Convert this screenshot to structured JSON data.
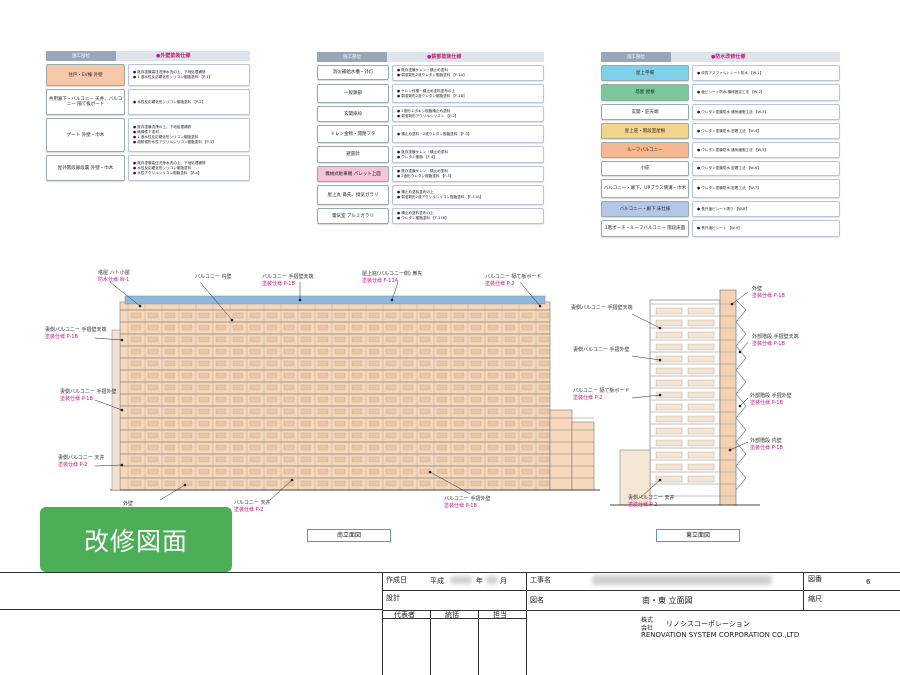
{
  "spec_tables": [
    {
      "header_label": "施工部位",
      "header_title": "●外壁塗装仕様",
      "rows": [
        {
          "name": "住戸・EV棟 外壁",
          "lines": [
            "● 既存塗膜高圧洗浄水洗の上、下地処理補修",
            "● 1 液水性反応硬化形シリコン樹脂塗料 【P-1】"
          ],
          "bg": "#f6c8a8"
        },
        {
          "name": "共用廊下・バルコニー 天井、バルコニー 隔て板ボード",
          "lines": [
            "● 水性反応硬化形シリコン樹脂塗料 【P-2】"
          ],
          "bg": "#ffffff"
        },
        {
          "name": "ゲート 外壁・巾木",
          "lines": [
            "● 既存塗膜洗浄の上、下地処理補修",
            "● 微弾性下塗材",
            "● 1 液水性反応硬化形シリコン樹脂塗料",
            "● 超耐候形水性アクリルシリコン樹脂塗料 【P-3】"
          ],
          "bg": "#ffffff"
        },
        {
          "name": "屋外階段廊段裏 外壁・巾木",
          "lines": [
            "● 既存塗膜高圧洗浄水洗の上、下地処理補修",
            "● 水性反応硬化形シリコン樹脂塗料",
            "● 水性アクリルシリコン樹脂塗料 【P-4】"
          ],
          "bg": "#ffffff"
        }
      ]
    },
    {
      "header_label": "施工部位",
      "header_title": "●鉄部塗装仕様",
      "rows": [
        {
          "name": "消火補給水槽・外灯",
          "lines": [
            "● 既存塗膜ケレン・錆止め塗料",
            "● 弱溶剤形2液ウレタン樹脂塗料 【F-1A】"
          ],
          "bg": "#ffffff"
        },
        {
          "name": "一般鉄部",
          "lines": [
            "● ケレン作業・錆止め塗料塗布の上",
            "● 弱溶剤形2液ウレタン樹脂塗料 【F-1B】"
          ],
          "bg": "#ffffff"
        },
        {
          "name": "玄関扉枠",
          "lines": [
            "● 2液形エポキシ樹脂錆止め塗料",
            "● 弱溶剤形アクリルシリコン 【F-2】"
          ],
          "bg": "#ffffff"
        },
        {
          "name": "ドレン金物・開閉フタ",
          "lines": [
            "● 錆止め塗料・2液ウレタン樹脂塗料 【F-3】"
          ],
          "bg": "#ffffff"
        },
        {
          "name": "避雷針",
          "lines": [
            "● 既存塗膜ケレン・錆止め塗料",
            "● ウレタン樹脂 【F-4】"
          ],
          "bg": "#ffffff"
        },
        {
          "name": "機械式駐車機 パレット上面",
          "lines": [
            "● 既存塗膜ケレン・錆止め塗料",
            "● 2液形ウレタン樹脂塗料 【F-5】"
          ],
          "bg": "#f7c3d9"
        },
        {
          "name": "屋上丸 鼻先、換気ガラリ",
          "lines": [
            "● 錆止め塗料塗布の上",
            "● 弱溶剤形2液アクリルシリコン樹脂塗料 【F-11A】"
          ],
          "bg": "#ffffff"
        },
        {
          "name": "電気室 アルミガラリ",
          "lines": [
            "● 錆止め塗料塗布の上",
            "● ウレタン樹脂塗料 【F-11B】"
          ],
          "bg": "#ffffff"
        }
      ]
    },
    {
      "header_label": "施工部位",
      "header_title": "●防水改修仕様",
      "rows": [
        {
          "name": "屋上平場",
          "lines": [
            "● 改質アスファルトシート防水 【W-1】"
          ],
          "bg": "#7fd0e8"
        },
        {
          "name": "塔屋 屋根",
          "lines": [
            "● 塩ビシート防水 機械固定工法 【W-2】"
          ],
          "bg": "#7cc79b"
        },
        {
          "name": "玄関・庇天端",
          "lines": [
            "● ウレタン塗膜防水 通気緩衝工法 【W-3】"
          ],
          "bg": "#ffffff"
        },
        {
          "name": "屋上庇・階段室屋根",
          "lines": [
            "● ウレタン塗膜防水 密着工法 【W-4】"
          ],
          "bg": "#f2d58a"
        },
        {
          "name": "ルーフバルコニー",
          "lines": [
            "● ウレタン塗膜防水 通気緩衝工法 【W-5】"
          ],
          "bg": "#f6b88e"
        },
        {
          "name": "小庇",
          "lines": [
            "● ウレタン塗膜防水 密着工法 【W-6】"
          ],
          "bg": "#ffffff"
        },
        {
          "name": "バルコニー・廊下、UPプラス側溝・巾木",
          "lines": [
            "● ウレタン塗膜防水 密着工法 【W-7】"
          ],
          "bg": "#ffffff"
        },
        {
          "name": "バルコニー・廊下 床仕様",
          "lines": [
            "● 長尺塩ビシート張り 【W-8】"
          ],
          "bg": "#b4c6ea"
        },
        {
          "name": "1階ポーチ・ルーフバルコニー 階段床面",
          "lines": [
            "● 長尺塩ビシート 【W-9】"
          ],
          "bg": "#ffffff"
        }
      ]
    }
  ],
  "south_callouts": [
    {
      "title": "塔屋 ハト小屋",
      "spec": "防水仕様 W-1"
    },
    {
      "title": "バルコニー 内壁",
      "spec": ""
    },
    {
      "title": "バルコニー 手摺壁天端",
      "spec": "塗装仕様 P-1B"
    },
    {
      "title": "屋上庇(バルコニー側) 鼻先",
      "spec": "塗装仕様 F-11A"
    },
    {
      "title": "バルコニー 隔て板ボード",
      "spec": "塗装仕様 P-2"
    },
    {
      "title": "妻側バルコニー 手摺壁天端",
      "spec": "塗装仕様 P-1B"
    },
    {
      "title": "妻側バルコニー 手摺外壁",
      "spec": "塗装仕様 P-1B"
    },
    {
      "title": "妻側バルコニー 天井",
      "spec": "塗装仕様 P-2"
    },
    {
      "title": "外壁",
      "spec": "塗装仕様 P-1B"
    },
    {
      "title": "バルコニー 天井",
      "spec": "塗装仕様 P-2"
    },
    {
      "title": "バルコニー 手摺外壁",
      "spec": "塗装仕様 P-1B"
    }
  ],
  "east_callouts": [
    {
      "title": "妻側バルコニー 手摺壁天端",
      "spec": ""
    },
    {
      "title": "妻側バルコニー 手摺外壁",
      "spec": ""
    },
    {
      "title": "バルコニー 隔て板ボード",
      "spec": "塗装仕様 P-2"
    },
    {
      "title": "妻側バルコニー 天井",
      "spec": "塗装仕様 P-2"
    },
    {
      "title": "外壁",
      "spec": "塗装仕様 P-1B"
    },
    {
      "title": "外部階段 手摺壁天端",
      "spec": "塗装仕様 P-1B"
    },
    {
      "title": "外部階段 手摺外壁",
      "spec": "塗装仕様 P-1B"
    },
    {
      "title": "外部階段 内壁",
      "spec": "塗装仕様 P-1B"
    }
  ],
  "south_caption": "南立面図",
  "east_caption": "東立面図",
  "badge_text": "改修図面",
  "title_block": {
    "created_label": "作成日",
    "era": "平成",
    "year_unit": "年",
    "month_unit": "月",
    "design_label": "設計",
    "role_1": "代表者",
    "role_2": "統括",
    "role_3": "担当",
    "project_label": "工事名",
    "drawing_label": "図名",
    "drawing_name": "南・東 立面図",
    "company_prefix_1": "株式",
    "company_prefix_2": "会社",
    "company_jp": "リノシスコーポレーション",
    "company_en": "RENOVATION SYSTEM CORPORATION CO.,LTD",
    "sheet_label": "図番",
    "sheet_no": "6",
    "scale_label": "縮尺"
  }
}
